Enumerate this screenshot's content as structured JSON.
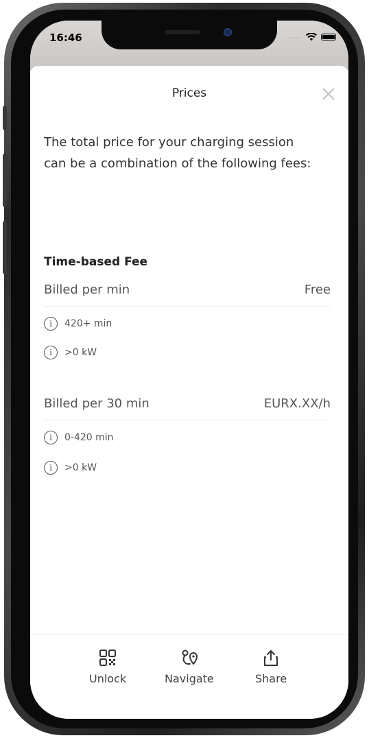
{
  "status_bar": {
    "time": "16:46",
    "signal": ".....",
    "icons": [
      "wifi-icon",
      "battery-icon"
    ]
  },
  "sheet": {
    "title": "Prices",
    "close_icon": "close-icon",
    "intro": "The total price for your charging session can be a combination of the following fees:"
  },
  "fees": {
    "section_title": "Time-based Fee",
    "items": [
      {
        "label": "Billed per min",
        "price": "Free",
        "conditions": [
          "420+ min",
          ">0 kW"
        ]
      },
      {
        "label": "Billed per 30 min",
        "price": "EURX.XX/h",
        "conditions": [
          "0-420 min",
          ">0 kW"
        ]
      }
    ]
  },
  "bottom_nav": {
    "unlock": {
      "label": "Unlock",
      "icon": "qr-code-icon"
    },
    "navigate": {
      "label": "Navigate",
      "icon": "route-icon"
    },
    "share": {
      "label": "Share",
      "icon": "share-icon"
    }
  },
  "colors": {
    "text_primary": "#222222",
    "text_secondary": "#555555",
    "divider": "#ececec",
    "frame": "#0b0b0b"
  }
}
